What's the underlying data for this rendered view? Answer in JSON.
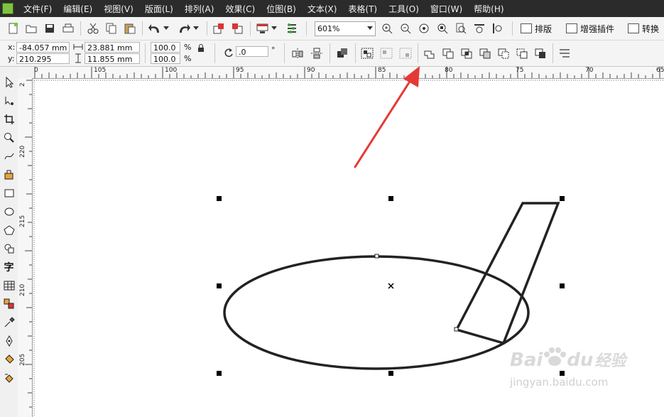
{
  "menu": {
    "items": [
      "文件(F)",
      "编辑(E)",
      "视图(V)",
      "版面(L)",
      "排列(A)",
      "效果(C)",
      "位图(B)",
      "文本(X)",
      "表格(T)",
      "工具(O)",
      "窗口(W)",
      "帮助(H)"
    ]
  },
  "toolbar": {
    "zoom_value": "601%",
    "plugins": [
      "排版",
      "增强插件",
      "转换"
    ]
  },
  "property_bar": {
    "x_label": "x:",
    "x_value": "-84.057 mm",
    "y_label": "y:",
    "y_value": "210.295 mm",
    "width_value": "23.881 mm",
    "height_value": "11.855 mm",
    "scale_x": "100.0",
    "scale_y": "100.0",
    "percent": "%",
    "rotation_value": ".0",
    "degree": "°"
  },
  "ruler_top": {
    "labels": [
      "105",
      "100",
      "95",
      "90",
      "85",
      "80",
      "75",
      "70",
      "65"
    ],
    "first_label": "0"
  },
  "ruler_left": {
    "labels": [
      "220",
      "215",
      "210",
      "205"
    ],
    "top_label": "2"
  },
  "watermark": {
    "main": "Bai",
    "main2": "du",
    "suffix": "经验",
    "url": "jingyan.baidu.com"
  },
  "colors": {
    "menubar": "#2b2b2b",
    "arrow": "#e53935",
    "shape_stroke": "#222222"
  }
}
